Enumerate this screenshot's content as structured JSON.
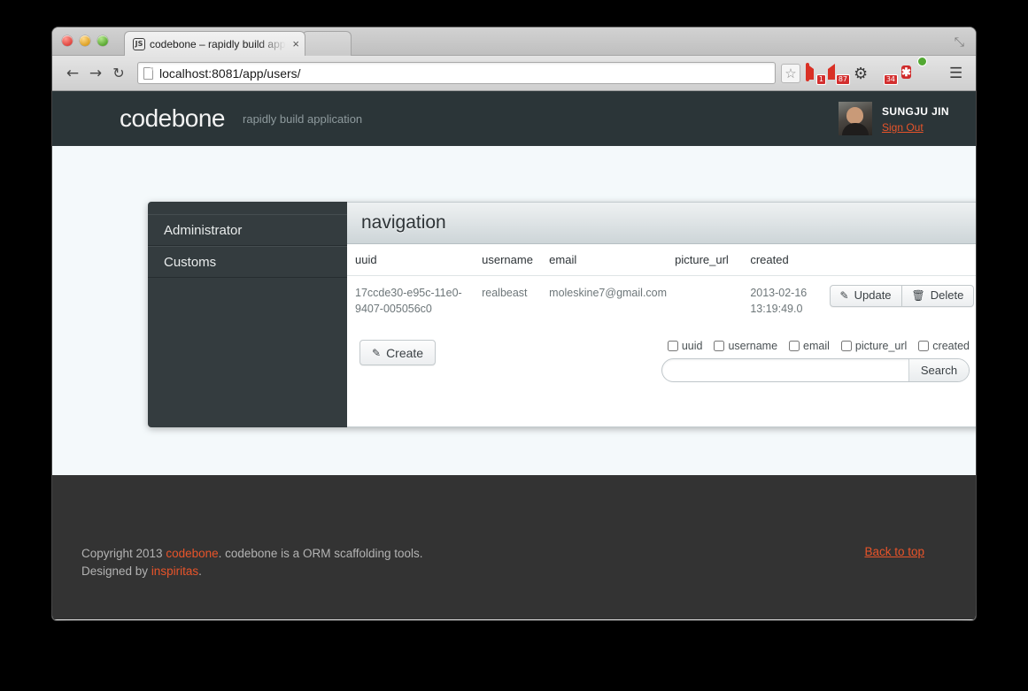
{
  "browser": {
    "tab": {
      "favicon": "js-favicon",
      "title": "codebone – rapidly build app",
      "close": "×"
    },
    "blank_tab_label": "",
    "back": "←",
    "forward": "→",
    "reload": "↻",
    "url": "localhost:8081/app/users/",
    "star": "☆",
    "maximize": "⤡",
    "menu": "☰",
    "extensions": [
      {
        "name": "gmail-icon",
        "badge": "1"
      },
      {
        "name": "rss-reader-icon",
        "badge": "87"
      },
      {
        "name": "gear-icon",
        "badge": ""
      },
      {
        "name": "pen-icon",
        "badge": "34"
      },
      {
        "name": "adblock-icon",
        "badge": "",
        "glyph": "✱"
      },
      {
        "name": "globe-icon",
        "badge": ""
      }
    ]
  },
  "header": {
    "logo": "codebone",
    "tagline": "rapidly build application",
    "username": "SUNGJU JIN",
    "signout": "Sign Out"
  },
  "sidebar": {
    "items": [
      {
        "label": "Administrator"
      },
      {
        "label": "Customs"
      }
    ]
  },
  "panel": {
    "title": "navigation",
    "columns": [
      "uuid",
      "username",
      "email",
      "picture_url",
      "created"
    ],
    "rows": [
      {
        "uuid": "17ccde30-e95c-11e0-9407-005056c0",
        "username": "realbeast",
        "email": "moleskine7@gmail.com",
        "picture_url": "",
        "created": "2013-02-16 13:19:49.0",
        "update_label": "Update",
        "delete_label": "Delete"
      }
    ],
    "create_label": "Create",
    "search": {
      "checkboxes": [
        "uuid",
        "username",
        "email",
        "picture_url",
        "created"
      ],
      "input_value": "",
      "placeholder": "",
      "button_label": "Search"
    }
  },
  "footer": {
    "copyright_pre": "Copyright 2013 ",
    "brand": "codebone",
    "copyright_post": ". codebone is a ORM scaffolding tools.",
    "designed_pre": "Designed by ",
    "designer": "inspiritas",
    "designed_post": ".",
    "back_to_top": "Back to top"
  },
  "colors": {
    "accent": "#e8542a",
    "header_bg": "#2b3538",
    "sidebar_bg": "#343c3f",
    "footer_bg": "#333333",
    "page_bg": "#f4f9fb"
  }
}
